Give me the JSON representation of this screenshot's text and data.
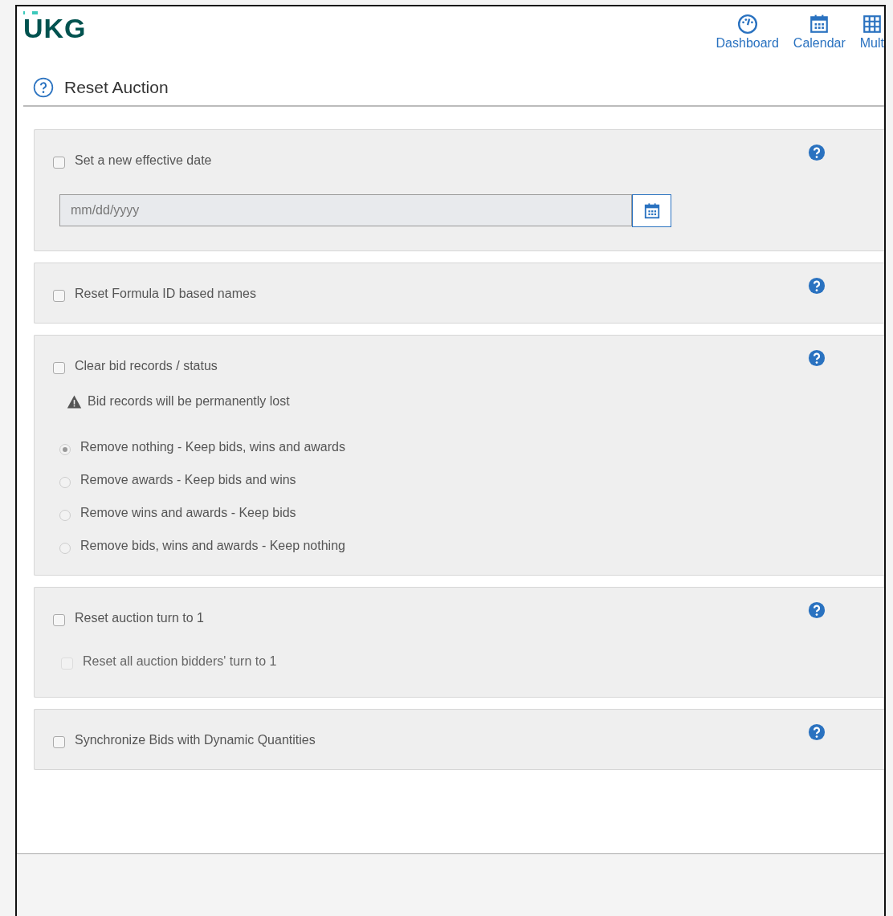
{
  "logo": {
    "text": "UKG"
  },
  "nav": [
    {
      "label": "Dashboard"
    },
    {
      "label": "Calendar"
    },
    {
      "label": "Mult"
    }
  ],
  "page_title": "Reset Auction",
  "sections": [
    {
      "items": [
        {
          "kind": "checkbox",
          "label": "Set a new effective date",
          "checked": false,
          "disabled": false
        },
        {
          "kind": "date",
          "placeholder": "mm/dd/yyyy"
        }
      ]
    },
    {
      "items": [
        {
          "kind": "checkbox",
          "label": "Reset Formula ID based names",
          "checked": false,
          "disabled": false
        }
      ]
    },
    {
      "items": [
        {
          "kind": "checkbox",
          "label": "Clear bid records / status",
          "checked": false,
          "disabled": false
        },
        {
          "kind": "warning",
          "text": "Bid records will be permanently lost"
        },
        {
          "kind": "radio",
          "label": "Remove nothing - Keep bids, wins and awards",
          "selected": true
        },
        {
          "kind": "radio",
          "label": "Remove awards - Keep bids and wins",
          "selected": false
        },
        {
          "kind": "radio",
          "label": "Remove wins and awards - Keep bids",
          "selected": false
        },
        {
          "kind": "radio",
          "label": "Remove bids, wins and awards - Keep nothing",
          "selected": false
        }
      ]
    },
    {
      "items": [
        {
          "kind": "checkbox",
          "label": "Reset auction turn to 1",
          "checked": false,
          "disabled": false
        },
        {
          "kind": "checkbox",
          "label": "Reset all auction bidders' turn to 1",
          "checked": false,
          "disabled": true
        }
      ]
    },
    {
      "items": [
        {
          "kind": "checkbox",
          "label": "Synchronize Bids with Dynamic Quantities",
          "checked": false,
          "disabled": false
        }
      ]
    }
  ]
}
